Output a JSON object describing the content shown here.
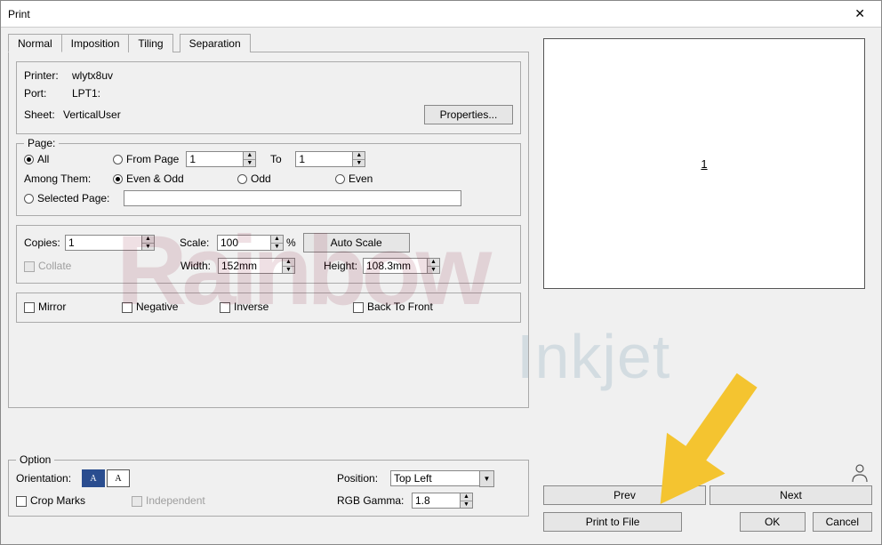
{
  "window": {
    "title": "Print"
  },
  "tabs": {
    "normal": "Normal",
    "imposition": "Imposition",
    "tiling": "Tiling",
    "separation": "Separation"
  },
  "printer": {
    "printer_label": "Printer:",
    "printer_value": "wlytx8uv",
    "port_label": "Port:",
    "port_value": "LPT1:",
    "sheet_label": "Sheet:",
    "sheet_value": "VerticalUser",
    "properties_btn": "Properties..."
  },
  "page": {
    "legend": "Page:",
    "all": "All",
    "from_page": "From Page",
    "from_value": "1",
    "to": "To",
    "to_value": "1",
    "among_label": "Among Them:",
    "even_odd": "Even & Odd",
    "odd": "Odd",
    "even": "Even",
    "selected_page": "Selected Page:",
    "selected_value": ""
  },
  "copies": {
    "copies_label": "Copies:",
    "copies_value": "1",
    "scale_label": "Scale:",
    "scale_value": "100",
    "percent": "%",
    "auto_scale": "Auto Scale",
    "collate": "Collate",
    "width_label": "Width:",
    "width_value": "152mm",
    "height_label": "Height:",
    "height_value": "108.3mm"
  },
  "print_opts": {
    "mirror": "Mirror",
    "negative": "Negative",
    "inverse": "Inverse",
    "back_to_front": "Back To Front"
  },
  "option": {
    "legend": "Option",
    "orientation_label": "Orientation:",
    "crop_marks": "Crop Marks",
    "independent": "Independent",
    "position_label": "Position:",
    "position_value": "Top Left",
    "gamma_label": "RGB Gamma:",
    "gamma_value": "1.8"
  },
  "preview": {
    "page_indicator": "1"
  },
  "nav": {
    "prev": "Prev",
    "next": "Next"
  },
  "actions": {
    "print_to_file": "Print to File",
    "ok": "OK",
    "cancel": "Cancel"
  },
  "watermark": {
    "main": "Rainbow",
    "sub": "Inkjet"
  },
  "glyph": {
    "up": "▲",
    "down": "▼",
    "a_portrait": "A",
    "a_landscape": "A"
  }
}
